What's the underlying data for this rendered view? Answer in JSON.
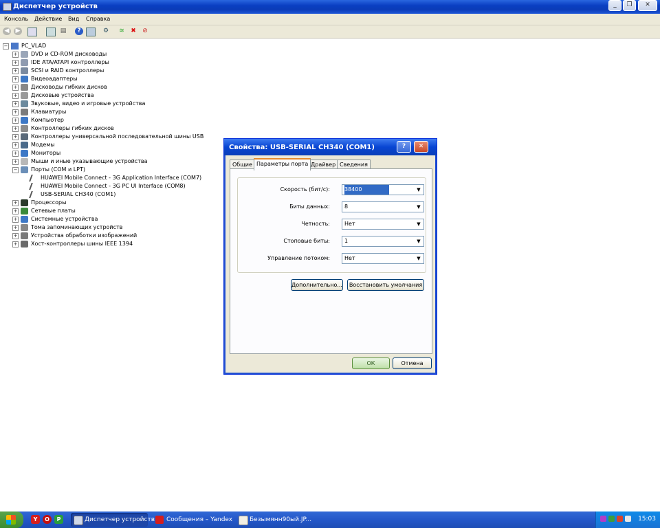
{
  "window": {
    "title": "Диспетчер устройств",
    "minimize_glyph": "_",
    "restore_glyph": "❐",
    "close_glyph": "✕"
  },
  "menu": [
    "Консоль",
    "Действие",
    "Вид",
    "Справка"
  ],
  "toolbar": {
    "buttons": [
      "back-icon",
      "forward-icon",
      "properties-icon",
      "console-tree-icon",
      "print-icon",
      "help-icon",
      "refresh-icon",
      "scan-hardware-icon",
      "update-driver-icon",
      "uninstall-icon",
      "disable-icon"
    ]
  },
  "tree": {
    "root": "PC_VLAD",
    "items": [
      {
        "label": "DVD и CD-ROM дисководы"
      },
      {
        "label": "IDE ATA/ATAPI контроллеры"
      },
      {
        "label": "SCSI и RAID контроллеры"
      },
      {
        "label": "Видеоадаптеры"
      },
      {
        "label": "Дисководы гибких дисков"
      },
      {
        "label": "Дисковые устройства"
      },
      {
        "label": "Звуковые, видео и игровые устройства"
      },
      {
        "label": "Клавиатуры"
      },
      {
        "label": "Компьютер"
      },
      {
        "label": "Контроллеры гибких дисков"
      },
      {
        "label": "Контроллеры универсальной последовательной шины USB"
      },
      {
        "label": "Модемы"
      },
      {
        "label": "Мониторы"
      },
      {
        "label": "Мыши и иные указывающие устройства"
      },
      {
        "label": "Порты (COM и LPT)",
        "expanded": true
      },
      {
        "label": "HUAWEI Mobile Connect - 3G Application Interface (COM7)",
        "child": true
      },
      {
        "label": "HUAWEI Mobile Connect - 3G PC UI Interface (COM8)",
        "child": true
      },
      {
        "label": "USB-SERIAL CH340 (COM1)",
        "child": true
      },
      {
        "label": "Процессоры"
      },
      {
        "label": "Сетевые платы"
      },
      {
        "label": "Системные устройства"
      },
      {
        "label": "Тома запоминающих устройств"
      },
      {
        "label": "Устройства обработки изображений"
      },
      {
        "label": "Хост-контроллеры шины IEEE 1394"
      }
    ]
  },
  "dialog": {
    "title": "Свойства: USB-SERIAL CH340 (COM1)",
    "help_glyph": "?",
    "close_glyph": "✕",
    "tabs": [
      "Общие",
      "Параметры порта",
      "Драйвер",
      "Сведения"
    ],
    "active_tab": "Параметры порта",
    "fields": [
      {
        "label": "Скорость (бит/с):",
        "value": "38400",
        "selected": true
      },
      {
        "label": "Биты данных:",
        "value": "8"
      },
      {
        "label": "Четность:",
        "value": "Нет"
      },
      {
        "label": "Стоповые биты:",
        "value": "1"
      },
      {
        "label": "Управление потоком:",
        "value": "Нет"
      }
    ],
    "advanced_button": "Дополнительно...",
    "restore_button": "Восстановить умолчания",
    "ok_button": "ОК",
    "cancel_button": "Отмена"
  },
  "taskbar": {
    "tasks": [
      {
        "label": "Диспетчер устройств",
        "active": true
      },
      {
        "label": "Сообщения – Yandex"
      },
      {
        "label": "Безымянн90ый.JP..."
      }
    ],
    "clock": "15:03"
  }
}
